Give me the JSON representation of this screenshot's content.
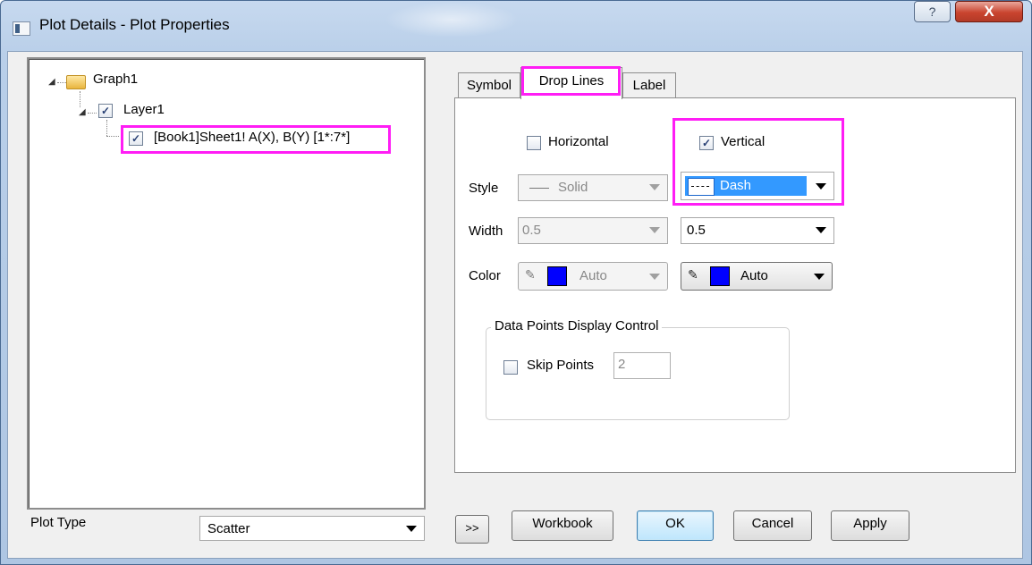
{
  "window": {
    "title": "Plot Details - Plot Properties",
    "help_glyph": "?",
    "close_glyph": "X"
  },
  "tree": {
    "root": "Graph1",
    "layer": "Layer1",
    "plot": "[Book1]Sheet1! A(X), B(Y) [1*:7*]"
  },
  "plot_type": {
    "label": "Plot Type",
    "value": "Scatter"
  },
  "tabs": [
    "Symbol",
    "Drop Lines",
    "Label"
  ],
  "active_tab": "Drop Lines",
  "drop_lines": {
    "horizontal": {
      "label": "Horizontal",
      "checked": false
    },
    "vertical": {
      "label": "Vertical",
      "checked": true
    },
    "style_label": "Style",
    "width_label": "Width",
    "color_label": "Color",
    "h_style": "Solid",
    "v_style": "Dash",
    "h_width": "0.5",
    "v_width": "0.5",
    "h_color": "Auto",
    "v_color": "Auto",
    "swatch_color": "#0000ff",
    "highlight_color": "#ff1df5"
  },
  "data_points": {
    "group_title": "Data Points Display Control",
    "skip_label": "Skip Points",
    "skip_value": "2",
    "skip_checked": false
  },
  "buttons": {
    "expand": ">>",
    "workbook": "Workbook",
    "ok": "OK",
    "cancel": "Cancel",
    "apply": "Apply"
  },
  "checkmark": "✓"
}
